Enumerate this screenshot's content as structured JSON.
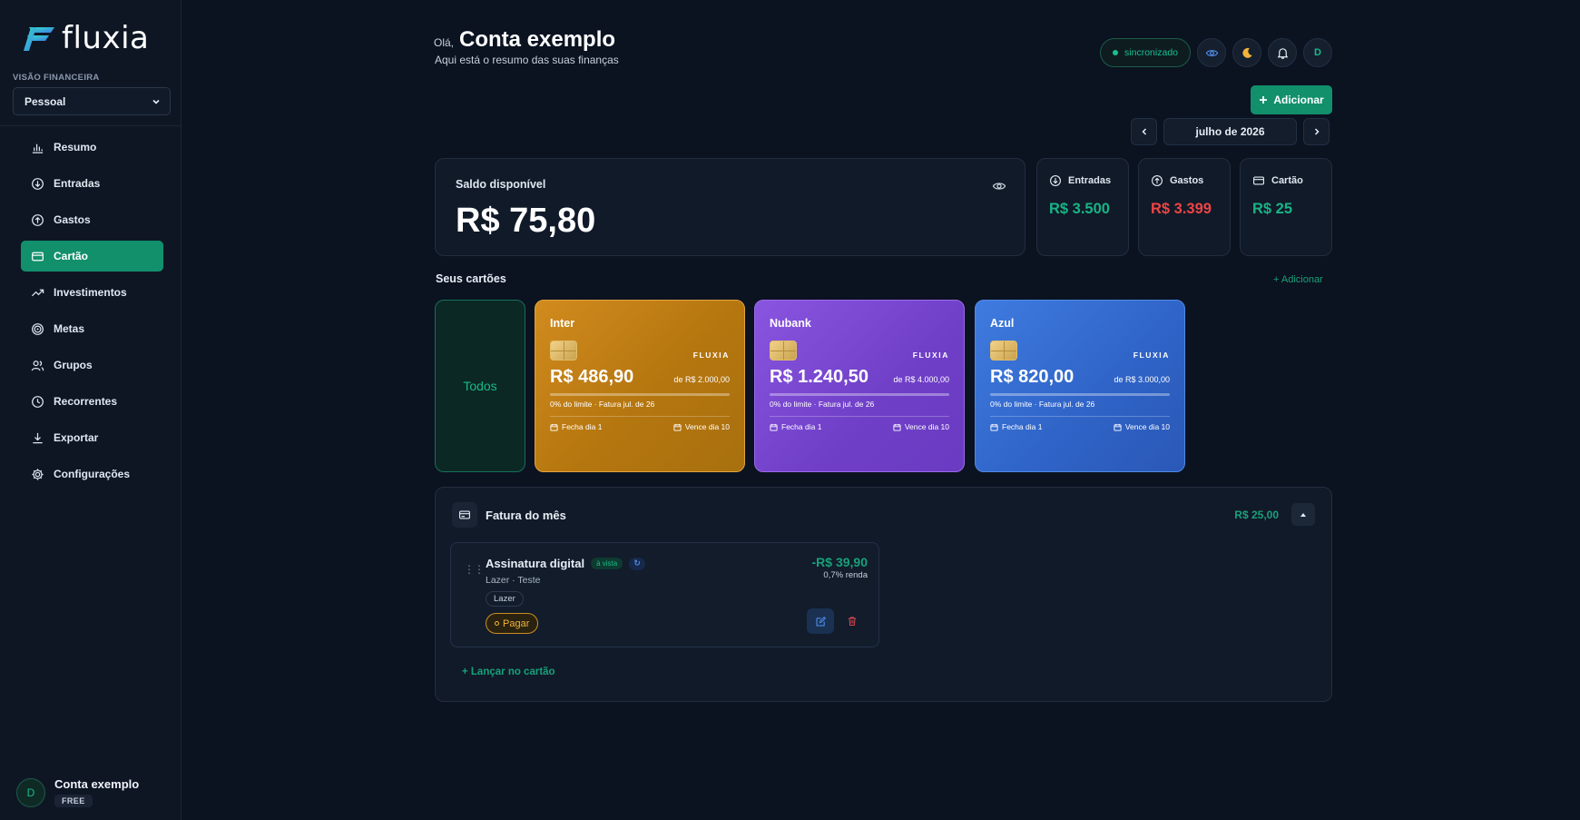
{
  "app": {
    "name": "fluxia"
  },
  "sidebar": {
    "section_label": "VISÃO FINANCEIRA",
    "view_select": "Pessoal",
    "items": [
      {
        "label": "Resumo",
        "icon": "bar-chart-icon"
      },
      {
        "label": "Entradas",
        "icon": "arrow-down-circle-icon"
      },
      {
        "label": "Gastos",
        "icon": "arrow-up-circle-icon"
      },
      {
        "label": "Cartão",
        "icon": "credit-card-icon",
        "active": true
      },
      {
        "label": "Investimentos",
        "icon": "trending-up-icon"
      },
      {
        "label": "Metas",
        "icon": "target-icon"
      },
      {
        "label": "Grupos",
        "icon": "users-icon"
      },
      {
        "label": "Recorrentes",
        "icon": "clock-icon"
      },
      {
        "label": "Exportar",
        "icon": "download-icon"
      },
      {
        "label": "Configurações",
        "icon": "gear-icon"
      }
    ],
    "user": {
      "avatar": "D",
      "name": "Conta exemplo",
      "plan": "FREE"
    }
  },
  "header": {
    "greeting": "Olá,",
    "name": "Conta exemplo",
    "subtitle": "Aqui está o resumo das suas finanças",
    "sync_status": "sincronizado",
    "avatar": "D",
    "add_label": "Adicionar",
    "month": "julho de 2026"
  },
  "summary": {
    "balance_label": "Saldo disponível",
    "balance_value": "R$ 75,80",
    "cards": [
      {
        "label": "Entradas",
        "value": "R$ 3.500",
        "color": "#18b486"
      },
      {
        "label": "Gastos",
        "value": "R$ 3.399",
        "color": "#ef4444"
      },
      {
        "label": "Cartão",
        "value": "R$ 25",
        "color": "#18b486"
      }
    ]
  },
  "cards_section": {
    "title": "Seus cartões",
    "add_label": "+ Adicionar",
    "all_label": "Todos",
    "cards": [
      {
        "name": "Inter",
        "brand": "FLUXIA",
        "amount": "R$ 486,90",
        "limit": "de R$ 2.000,00",
        "meta": "0% do limite · Fatura jul. de 26",
        "close": "Fecha dia 1",
        "due": "Vence dia 10",
        "color": "#c9841a"
      },
      {
        "name": "Nubank",
        "brand": "FLUXIA",
        "amount": "R$ 1.240,50",
        "limit": "de R$ 4.000,00",
        "meta": "0% do limite · Fatura jul. de 26",
        "close": "Fecha dia 1",
        "due": "Vence dia 10",
        "color": "#7c4ad6"
      },
      {
        "name": "Azul",
        "brand": "FLUXIA",
        "amount": "R$ 820,00",
        "limit": "de R$ 3.000,00",
        "meta": "0% do limite · Fatura jul. de 26",
        "close": "Fecha dia 1",
        "due": "Vence dia 10",
        "color": "#356fd6"
      }
    ]
  },
  "invoice": {
    "title": "Fatura do mês",
    "total": "R$ 25,00",
    "transaction": {
      "title": "Assinatura digital",
      "tag": "à vista",
      "subtitle": "Lazer · Teste",
      "category": "Lazer",
      "pay_label": "Pagar",
      "amount": "-R$ 39,90",
      "yield": "0,7% renda"
    },
    "launch_label": "+ Lançar no cartão"
  }
}
